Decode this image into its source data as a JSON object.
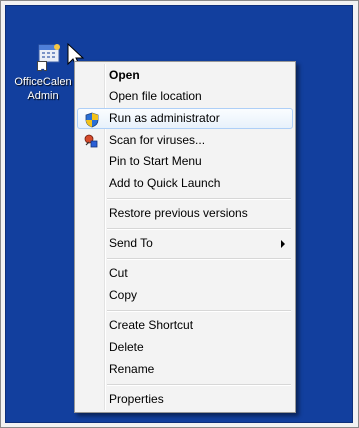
{
  "desktop": {
    "shortcut": {
      "label_line1": "OfficeCalen",
      "label_line2": "Admin",
      "icon": "calendar-shortcut-icon"
    }
  },
  "context_menu": {
    "items": [
      {
        "label": "Open",
        "bold": true
      },
      {
        "label": "Open file location"
      },
      {
        "label": "Run as administrator",
        "icon": "uac-shield-icon",
        "highlighted": true
      },
      {
        "label": "Scan for viruses...",
        "icon": "antivirus-icon"
      },
      {
        "label": "Pin to Start Menu"
      },
      {
        "label": "Add to Quick Launch"
      },
      {
        "label": "Restore previous versions"
      },
      {
        "label": "Send To",
        "has_submenu": true
      },
      {
        "label": "Cut"
      },
      {
        "label": "Copy"
      },
      {
        "label": "Create Shortcut"
      },
      {
        "label": "Delete"
      },
      {
        "label": "Rename"
      },
      {
        "label": "Properties"
      }
    ]
  },
  "colors": {
    "desktop_background": "#123f9e",
    "menu_background": "#f3f3f3",
    "highlight_border": "#aecff7"
  }
}
